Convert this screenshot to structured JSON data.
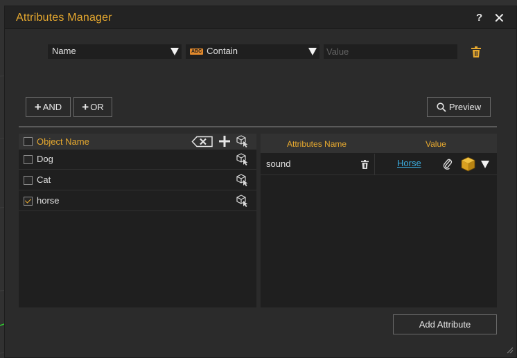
{
  "window": {
    "title": "Attributes Manager",
    "help_label": "?",
    "close_label": "✕"
  },
  "filter": {
    "field": "Name",
    "operator_badge": "ABC",
    "operator": "Contain",
    "value_placeholder": "Value",
    "value": ""
  },
  "buttons": {
    "and_label": "AND",
    "or_label": "OR",
    "preview_label": "Preview",
    "add_attribute_label": "Add Attribute"
  },
  "objects": {
    "header_label": "Object Name",
    "rows": [
      {
        "name": "Dog",
        "checked": false
      },
      {
        "name": "Cat",
        "checked": false
      },
      {
        "name": "horse",
        "checked": true
      }
    ]
  },
  "attributes": {
    "col_name": "Attributes Name",
    "col_value": "Value",
    "rows": [
      {
        "name": "sound",
        "value": "Horse"
      }
    ]
  },
  "colors": {
    "accent": "#e7a92f",
    "link": "#3cb0e4",
    "panel": "#1f1f1f",
    "background": "#2b2b2b"
  },
  "icons": [
    "trash-icon",
    "plus-icon",
    "search-icon",
    "clear-input-icon",
    "object-select-icon",
    "paperclip-icon",
    "cube-icon",
    "chevron-down-icon"
  ]
}
